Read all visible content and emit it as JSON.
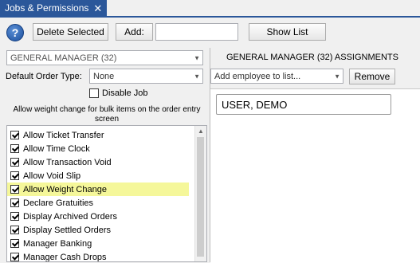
{
  "tab": {
    "title": "Jobs & Permissions",
    "close_glyph": "✕"
  },
  "toolbar": {
    "help_glyph": "?",
    "delete_selected_label": "Delete Selected",
    "add_label": "Add:",
    "add_value": "",
    "show_list_label": "Show List"
  },
  "job_select": {
    "value": "GENERAL MANAGER (32)"
  },
  "default_order_type": {
    "label": "Default Order Type:",
    "value": "None"
  },
  "disable_job": {
    "label": "Disable Job",
    "checked": false
  },
  "note": "Allow weight change for bulk items on the order entry screen",
  "permissions": [
    {
      "label": "Allow Ticket Transfer",
      "checked": true
    },
    {
      "label": "Allow Time Clock",
      "checked": true
    },
    {
      "label": "Allow Transaction Void",
      "checked": true
    },
    {
      "label": "Allow Void Slip",
      "checked": true
    },
    {
      "label": "Allow Weight Change",
      "checked": true,
      "highlighted": true
    },
    {
      "label": "Declare Gratuities",
      "checked": true
    },
    {
      "label": "Display Archived Orders",
      "checked": true
    },
    {
      "label": "Display Settled Orders",
      "checked": true
    },
    {
      "label": "Manager Banking",
      "checked": true
    },
    {
      "label": "Manager Cash Drops",
      "checked": true
    }
  ],
  "assignments": {
    "title": "GENERAL MANAGER (32) ASSIGNMENTS",
    "employee_placeholder": "Add employee to list...",
    "remove_label": "Remove",
    "items": [
      "USER, DEMO"
    ]
  },
  "colors": {
    "accent": "#2b579a",
    "highlight": "#f5f79a"
  }
}
